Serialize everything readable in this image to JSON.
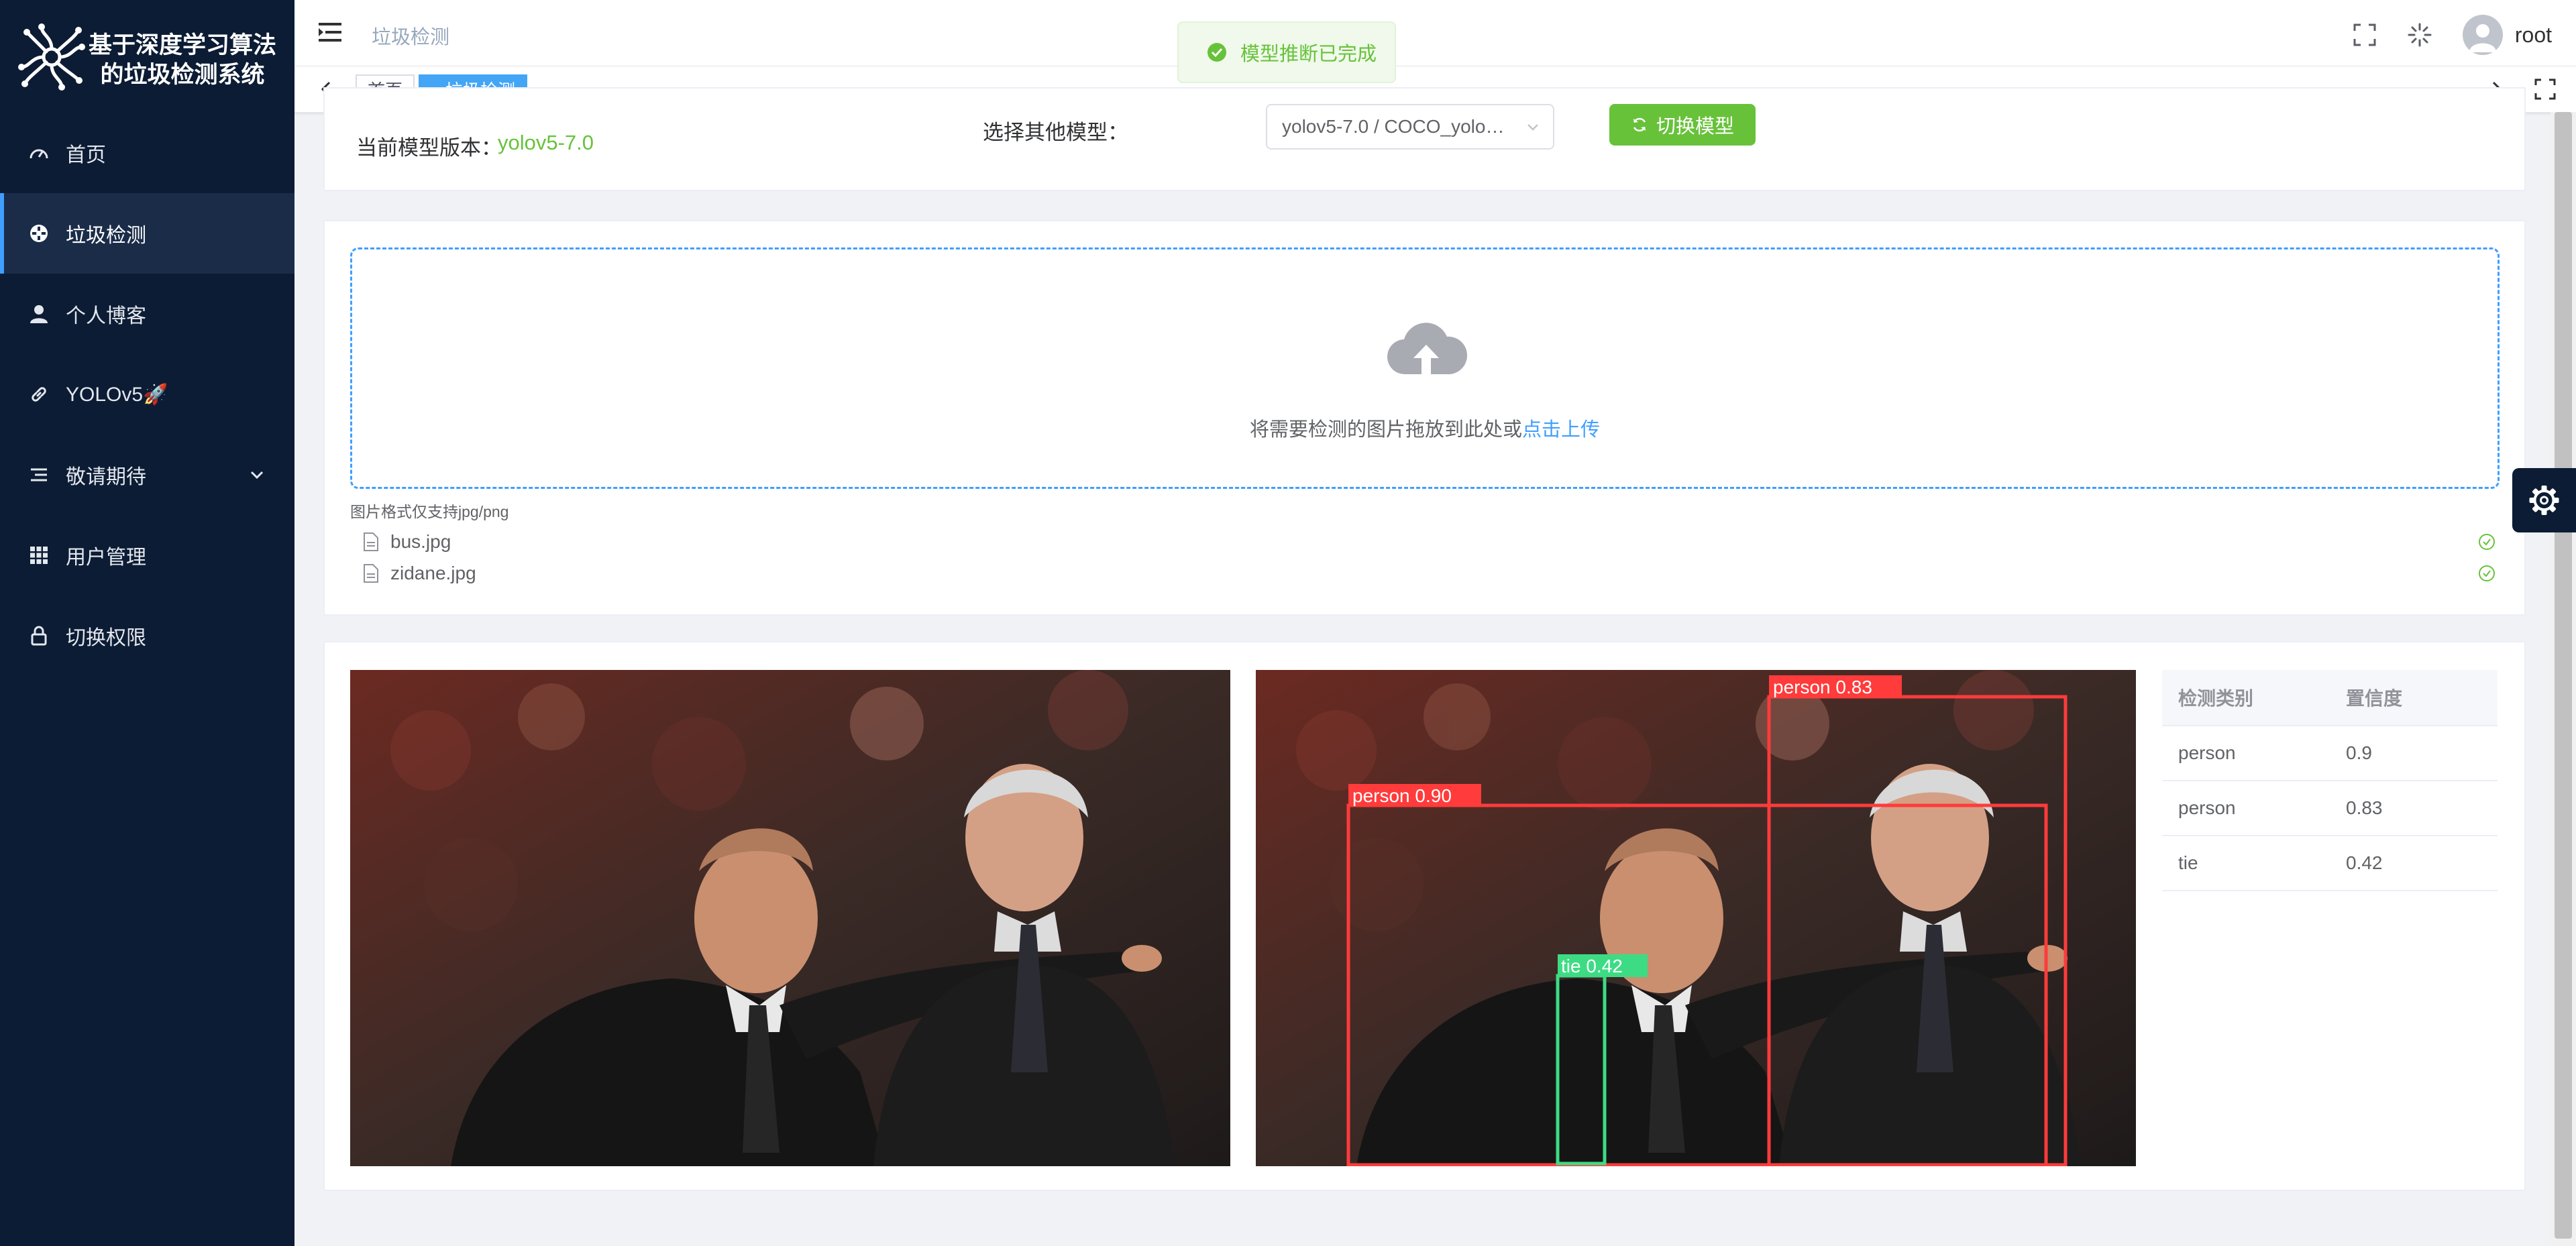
{
  "app": {
    "title": "基于深度学习算法的垃圾检测系统"
  },
  "sidebar": {
    "items": [
      {
        "label": "首页",
        "icon": "dashboard-icon"
      },
      {
        "label": "垃圾检测",
        "icon": "detect-icon",
        "active": true
      },
      {
        "label": "个人博客",
        "icon": "user-icon"
      },
      {
        "label": "YOLOv5🚀",
        "icon": "link-icon"
      },
      {
        "label": "敬请期待",
        "icon": "list-icon",
        "has_submenu": true
      },
      {
        "label": "用户管理",
        "icon": "grid-icon"
      },
      {
        "label": "切换权限",
        "icon": "lock-icon"
      }
    ]
  },
  "navbar": {
    "breadcrumb": "垃圾检测",
    "username": "root"
  },
  "tags": {
    "items": [
      "首页",
      "垃圾检测"
    ],
    "active_index": 1
  },
  "toast": {
    "message": "模型推断已完成",
    "type": "success"
  },
  "model": {
    "current_label": "当前模型版本：",
    "current_value": "yolov5-7.0",
    "select_label": "选择其他模型：",
    "select_value": "yolov5-7.0 / COCO_yolo…",
    "switch_button": "切换模型"
  },
  "upload": {
    "prompt": "将需要检测的图片拖放到此处或",
    "link": "点击上传",
    "tip": "图片格式仅支持jpg/png",
    "files": [
      "bus.jpg",
      "zidane.jpg"
    ]
  },
  "detections": [
    {
      "label": "person 0.90",
      "color": "#ff3b3b"
    },
    {
      "label": "person 0.83",
      "color": "#ff3b3b"
    },
    {
      "label": "tie 0.42",
      "color": "#3ddc84"
    }
  ],
  "results": {
    "headers": [
      "检测类别",
      "置信度"
    ],
    "rows": [
      [
        "person",
        "0.9"
      ],
      [
        "person",
        "0.83"
      ],
      [
        "tie",
        "0.42"
      ]
    ]
  },
  "colors": {
    "sidebar_bg": "#0c1c34",
    "primary": "#409eff",
    "success": "#67c23a"
  }
}
